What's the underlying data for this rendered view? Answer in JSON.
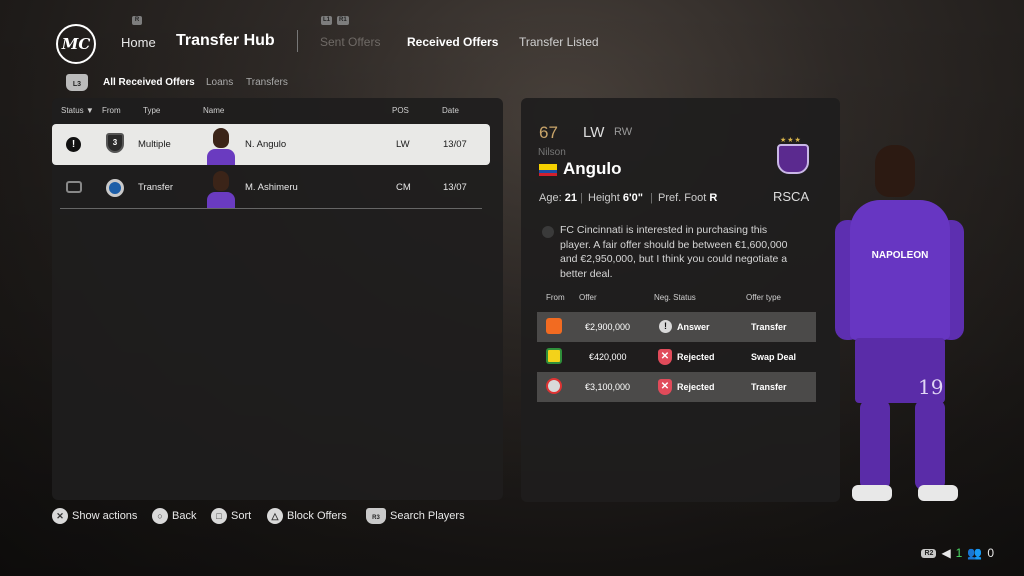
{
  "logo": "MC",
  "nav": {
    "home": "Home",
    "hub": "Transfer Hub",
    "tabs": [
      "Sent Offers",
      "Received Offers",
      "Transfer Listed"
    ],
    "hint_left": "L1",
    "hint_right": "R1",
    "hint_home": "R"
  },
  "subtabs": {
    "hint": "L3",
    "items": [
      "All Received Offers",
      "Loans",
      "Transfers"
    ]
  },
  "table": {
    "columns": [
      "Status",
      "From",
      "Type",
      "Name",
      "POS",
      "Date"
    ],
    "rows": [
      {
        "status_icon": "exclamation-icon",
        "from_badge": "3",
        "type": "Multiple",
        "name": "N. Angulo",
        "pos": "LW",
        "date": "13/07"
      },
      {
        "status_icon": "tv-icon",
        "from_badge": "",
        "type": "Transfer",
        "name": "M. Ashimeru",
        "pos": "CM",
        "date": "13/07"
      }
    ]
  },
  "player": {
    "rating": "67",
    "position": "LW",
    "alt_position": "RW",
    "first_name": "Nilson",
    "surname": "Angulo",
    "club": "RSCA",
    "age_label": "Age:",
    "age": "21",
    "height_label": "Height",
    "height": "6'0\"",
    "foot_label": "Pref. Foot",
    "foot": "R",
    "message": "FC Cincinnati is interested in purchasing this player. A fair offer should be between €1,600,000 and €2,950,000, but I think you could negotiate a better deal.",
    "shirt_sponsor": "NAPOLEON",
    "shirt_number": "19"
  },
  "offers": {
    "columns": [
      "From",
      "Offer",
      "Neg. Status",
      "Offer type"
    ],
    "rows": [
      {
        "offer": "€2,900,000",
        "status": "Answer",
        "type": "Transfer",
        "crest_color": "#f26b21"
      },
      {
        "offer": "€420,000",
        "status": "Rejected",
        "type": "Swap Deal",
        "crest_color": "#f3d21a"
      },
      {
        "offer": "€3,100,000",
        "status": "Rejected",
        "type": "Transfer",
        "crest_color": "#d9d9d9"
      }
    ]
  },
  "actions": [
    {
      "button": "✕",
      "label": "Show actions"
    },
    {
      "button": "○",
      "label": "Back"
    },
    {
      "button": "□",
      "label": "Sort"
    },
    {
      "button": "△",
      "label": "Block Offers"
    },
    {
      "button": "R3",
      "label": "Search Players"
    }
  ],
  "corner": {
    "r2": "R2",
    "count1": "1",
    "count2": "0"
  }
}
